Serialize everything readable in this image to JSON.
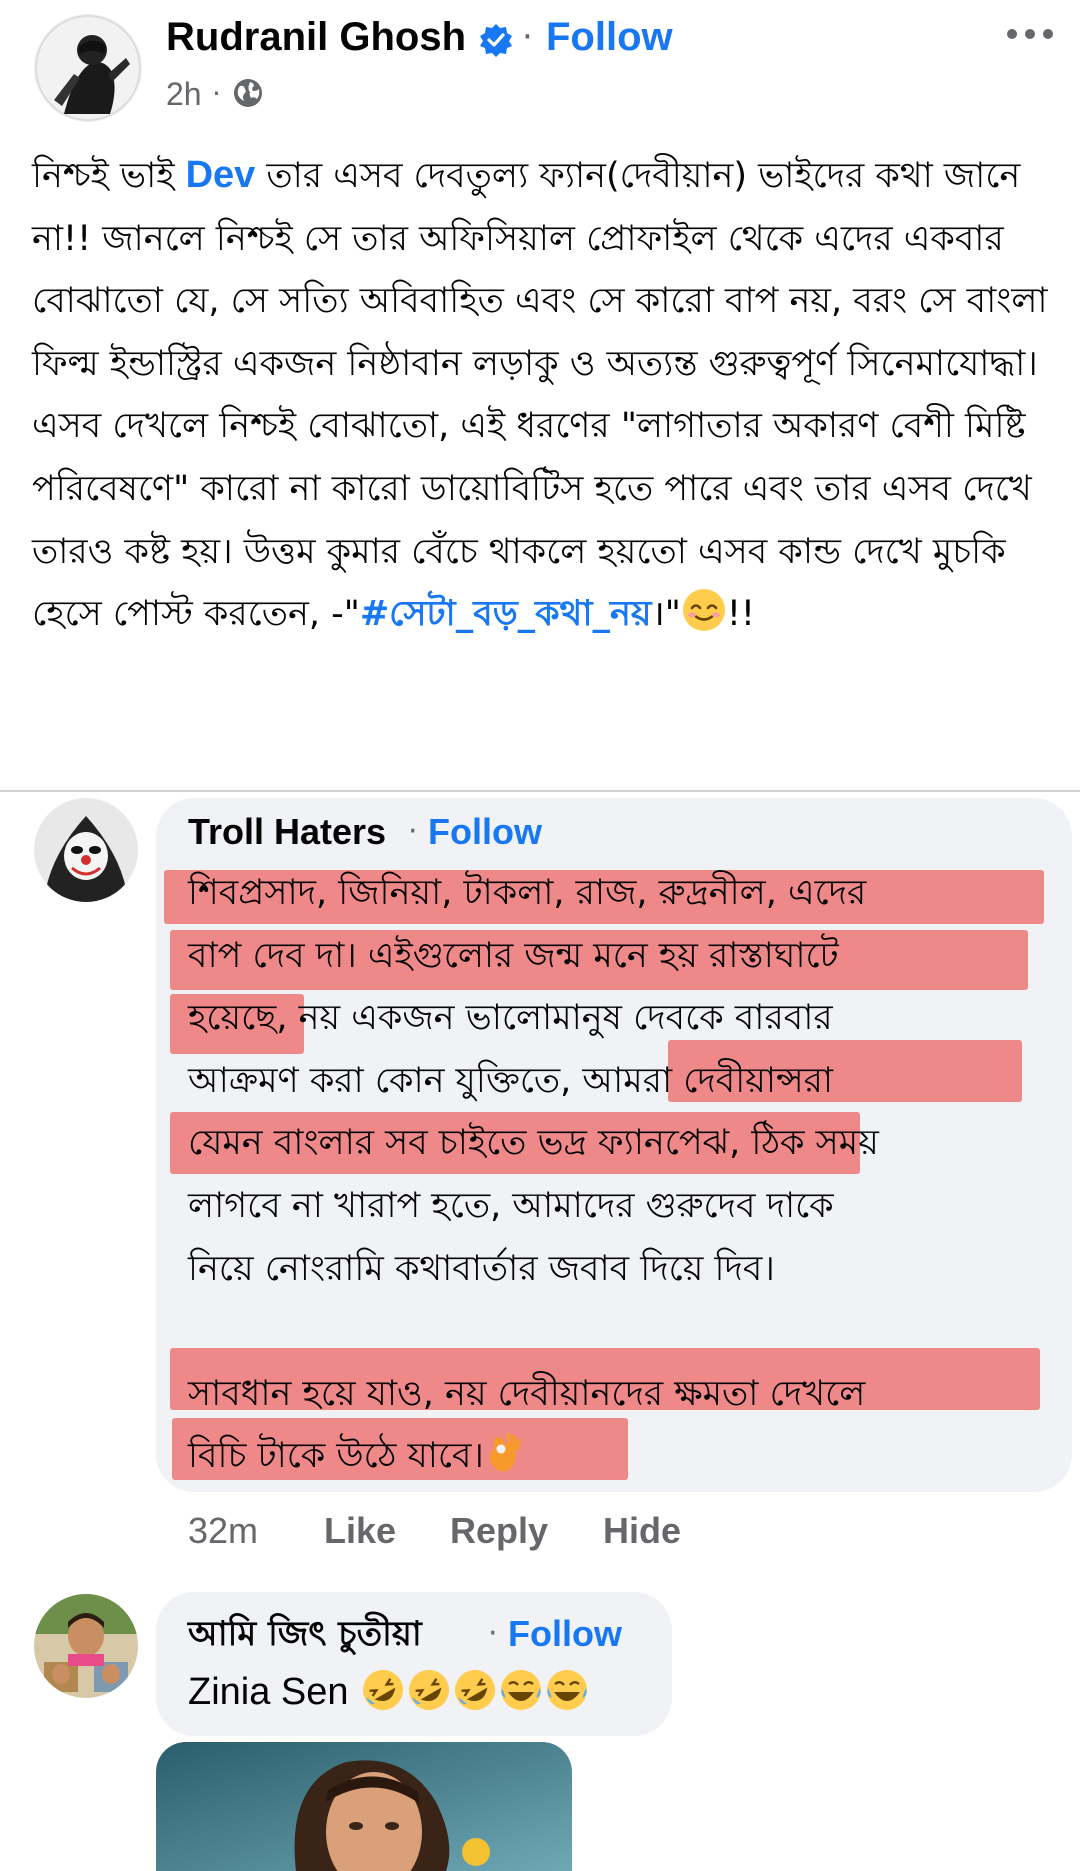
{
  "post": {
    "author": "Rudranil Ghosh",
    "follow_label": "Follow",
    "separator": "·",
    "time": "2h",
    "text_before_mention": "নিশ্চই ভাই ",
    "mention": "Dev",
    "text_after_mention": "  তার এসব দেবতুল্য ফ্যান(দেবীয়ান) ভাইদের কথা জানে না!! জানলে নিশ্চই সে তার অফিসিয়াল প্রোফাইল থেকে এদের একবার বোঝাতো যে, সে সত্যি অবিবাহিত এবং সে কারো বাপ নয়, বরং সে  বাংলা ফিল্ম ইন্ডাস্ট্রির একজন নিষ্ঠাবান লড়াকু ও অত্যন্ত গুরুত্বপূর্ণ সিনেমাযোদ্ধা। এসব দেখলে নিশ্চই বোঝাতো, এই ধরণের \"লাগাতার অকারণ বেশী মিষ্টি পরিবেষণে\" কারো না কারো ডায়োবিটিস হতে পারে এবং তার এসব দেখে তারও কষ্ট হয়। উত্তম কুমার বেঁচে থাকলে হয়তো এসব কান্ড দেখে মুচকি হেসে পোস্ট করতেন, -\"",
    "hashtag": "#সেটা_বড়_কথা_নয়",
    "text_end": "।\"",
    "text_tail": "!!"
  },
  "comments": [
    {
      "author": "Troll Haters",
      "follow_label": "Follow",
      "separator": "·",
      "lines": [
        "শিবপ্রসাদ, জিনিয়া, টাকলা, রাজ, রুদ্রনীল, এদের",
        "বাপ দেব দা।  এইগুলোর জন্ম মনে হয় রাস্তাঘাটে",
        "হয়েছে, নয় একজন ভালোমানুষ দেবকে বারবার",
        "আক্রমণ করা কোন যুক্তিতে, আমরা দেবীয়ান্সরা",
        "যেমন বাংলার সব চাইতে ভদ্র ফ্যানপেঝ, ঠিক সময়",
        "লাগবে না খারাপ হতে, আমাদের গুরুদেব দাকে",
        "নিয়ে নোংরামি কথাবার্তার জবাব দিয়ে দিব।",
        "",
        "সাবধান হয়ে যাও, নয় দেবীয়ানদের ক্ষমতা দেখলে",
        "বিচি টাকে উঠে যাবে।"
      ],
      "time": "32m",
      "like_label": "Like",
      "reply_label": "Reply",
      "hide_label": "Hide"
    },
    {
      "author": "আমি জিৎ চুতীয়া",
      "follow_label": "Follow",
      "separator": "·",
      "text": "Zinia Sen"
    }
  ],
  "colors": {
    "link_blue": "#1877f2",
    "secondary_text": "#65676b",
    "bubble_bg": "#f0f2f5",
    "highlight_red": "#ee8889"
  },
  "icons": [
    "verified-badge-icon",
    "globe-icon",
    "more-options-icon",
    "smile-emoji-icon",
    "ok-hand-emoji-icon",
    "laughing-emoji-icon"
  ]
}
